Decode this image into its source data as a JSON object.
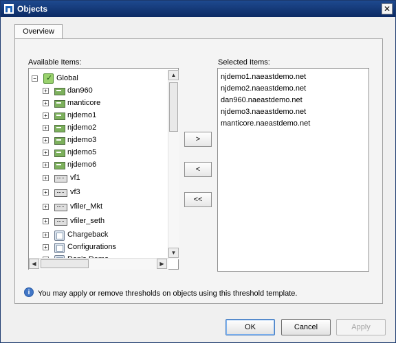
{
  "window": {
    "title": "Objects",
    "close_glyph": "✕"
  },
  "tabs": [
    {
      "label": "Overview"
    }
  ],
  "available": {
    "label": "Available Items:",
    "root": "Global",
    "items": [
      {
        "label": "dan960",
        "icon": "storage-server-icon"
      },
      {
        "label": "manticore",
        "icon": "storage-server-icon"
      },
      {
        "label": "njdemo1",
        "icon": "storage-server-icon"
      },
      {
        "label": "njdemo2",
        "icon": "storage-server-icon"
      },
      {
        "label": "njdemo3",
        "icon": "storage-server-icon"
      },
      {
        "label": "njdemo5",
        "icon": "storage-server-icon"
      },
      {
        "label": "njdemo6",
        "icon": "storage-server-icon"
      },
      {
        "label": "vf1",
        "icon": "vfiler-icon"
      },
      {
        "label": "vf3",
        "icon": "vfiler-icon"
      },
      {
        "label": "vfiler_Mkt",
        "icon": "vfiler-icon"
      },
      {
        "label": "vfiler_seth",
        "icon": "vfiler-icon"
      },
      {
        "label": "Chargeback",
        "icon": "group-icon"
      },
      {
        "label": "Configurations",
        "icon": "group-icon"
      },
      {
        "label": "Dan's Demo",
        "icon": "group-icon"
      }
    ]
  },
  "selected": {
    "label": "Selected Items:",
    "items": [
      "njdemo1.naeastdemo.net",
      "njdemo2.naeastdemo.net",
      "dan960.naeastdemo.net",
      "njdemo3.naeastdemo.net",
      "manticore.naeastdemo.net"
    ]
  },
  "move_buttons": {
    "add": ">",
    "remove": "<",
    "remove_all": "<<"
  },
  "info": "You may apply or remove thresholds on objects using this threshold template.",
  "buttons": {
    "ok": "OK",
    "cancel": "Cancel",
    "apply": "Apply"
  }
}
